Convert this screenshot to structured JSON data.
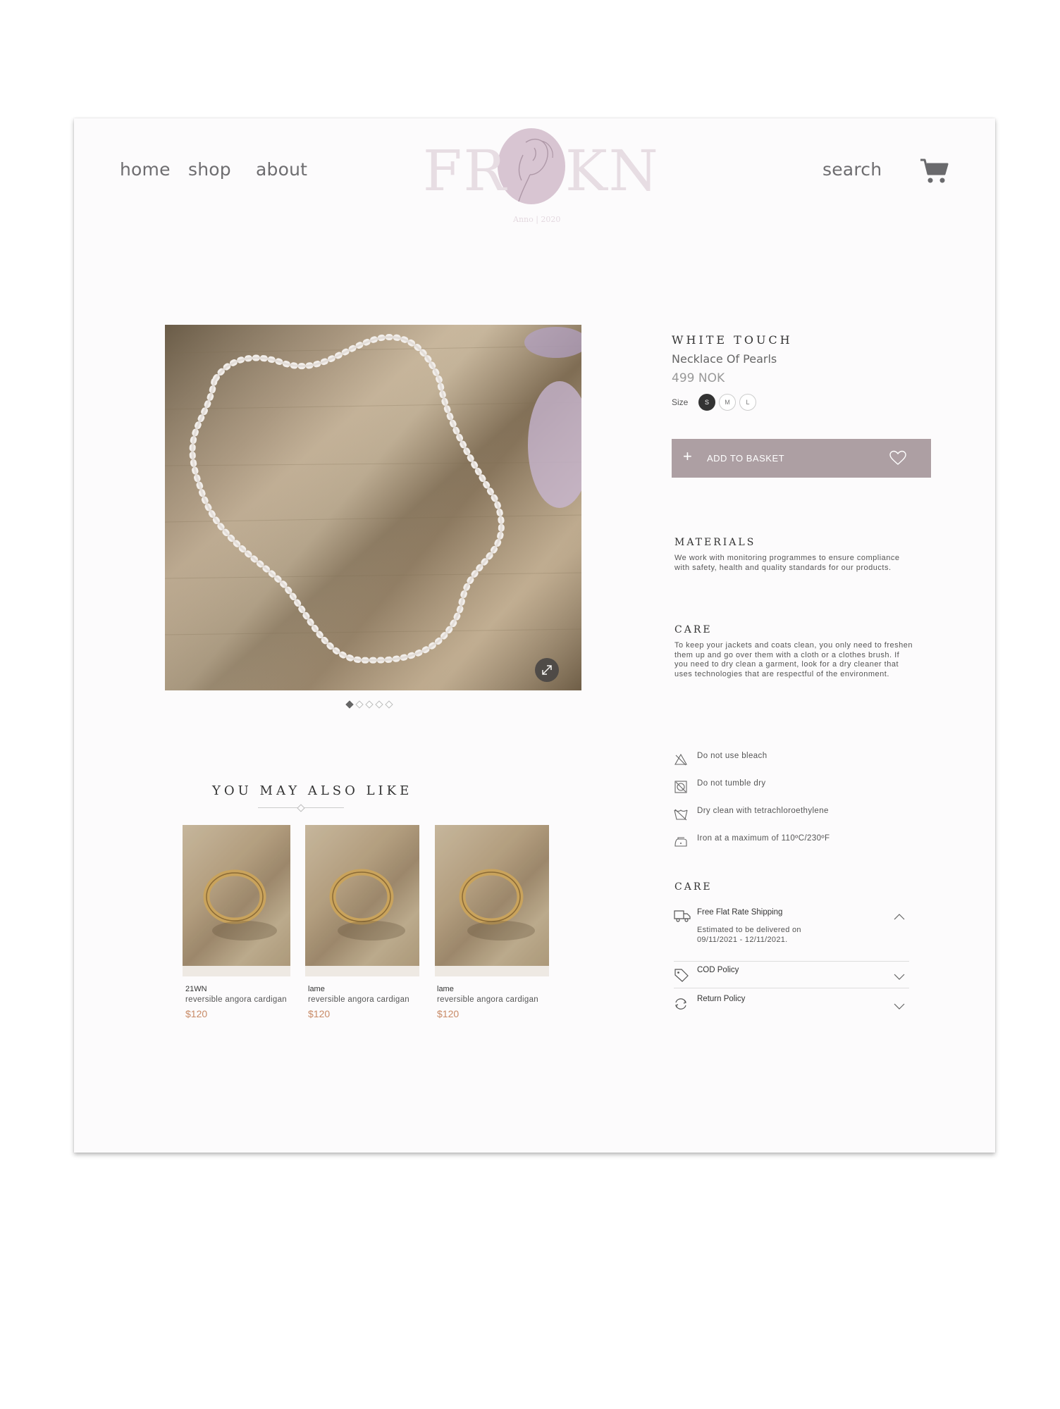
{
  "nav": {
    "home": "home",
    "shop": "shop",
    "about": "about",
    "search": "search"
  },
  "logo": {
    "left": "FR",
    "right": "KN",
    "sub": "Anno | 2020"
  },
  "gallery": {
    "dots": 5,
    "active_dot": 0
  },
  "product": {
    "title": "WHITE TOUCH",
    "subtitle": "Necklace Of Pearls",
    "price": "499 NOK",
    "size_label": "Size",
    "sizes": [
      "S",
      "M",
      "L"
    ],
    "selected_size": "S",
    "add_to_basket": "ADD TO BASKET",
    "accent_color": "#ad9fa3"
  },
  "materials": {
    "heading": "MATERIALS",
    "body": "We work with monitoring programmes to ensure compliance with safety, health and quality standards for our products."
  },
  "care": {
    "heading": "CARE",
    "body": "To keep your jackets and coats clean, you only need to freshen them up and go over them with a cloth or a clothes brush. If you need to dry clean a garment, look for a dry cleaner that uses technologies that are respectful of the environment."
  },
  "care_instructions": [
    {
      "icon": "no-bleach-icon",
      "text": "Do not use bleach"
    },
    {
      "icon": "no-tumble-dry-icon",
      "text": "Do not tumble dry"
    },
    {
      "icon": "dry-clean-icon",
      "text": "Dry clean with tetrachloroethylene"
    },
    {
      "icon": "iron-icon",
      "text": "Iron at a maximum of 110ºC/230ºF"
    }
  ],
  "policies": {
    "heading": "CARE",
    "shipping": {
      "title": "Free Flat Rate Shipping",
      "detail_line1": "Estimated to be delivered on",
      "detail_line2": "09/11/2021 - 12/11/2021."
    },
    "cod": {
      "title": "COD Policy"
    },
    "return": {
      "title": "Return Policy"
    }
  },
  "also_like": {
    "heading": "YOU MAY ALSO LIKE",
    "items": [
      {
        "brand": "21WN",
        "name": "reversible angora cardigan",
        "price": "$120"
      },
      {
        "brand": "lame",
        "name": "reversible angora cardigan",
        "price": "$120"
      },
      {
        "brand": "lame",
        "name": "reversible angora cardigan",
        "price": "$120"
      }
    ]
  }
}
